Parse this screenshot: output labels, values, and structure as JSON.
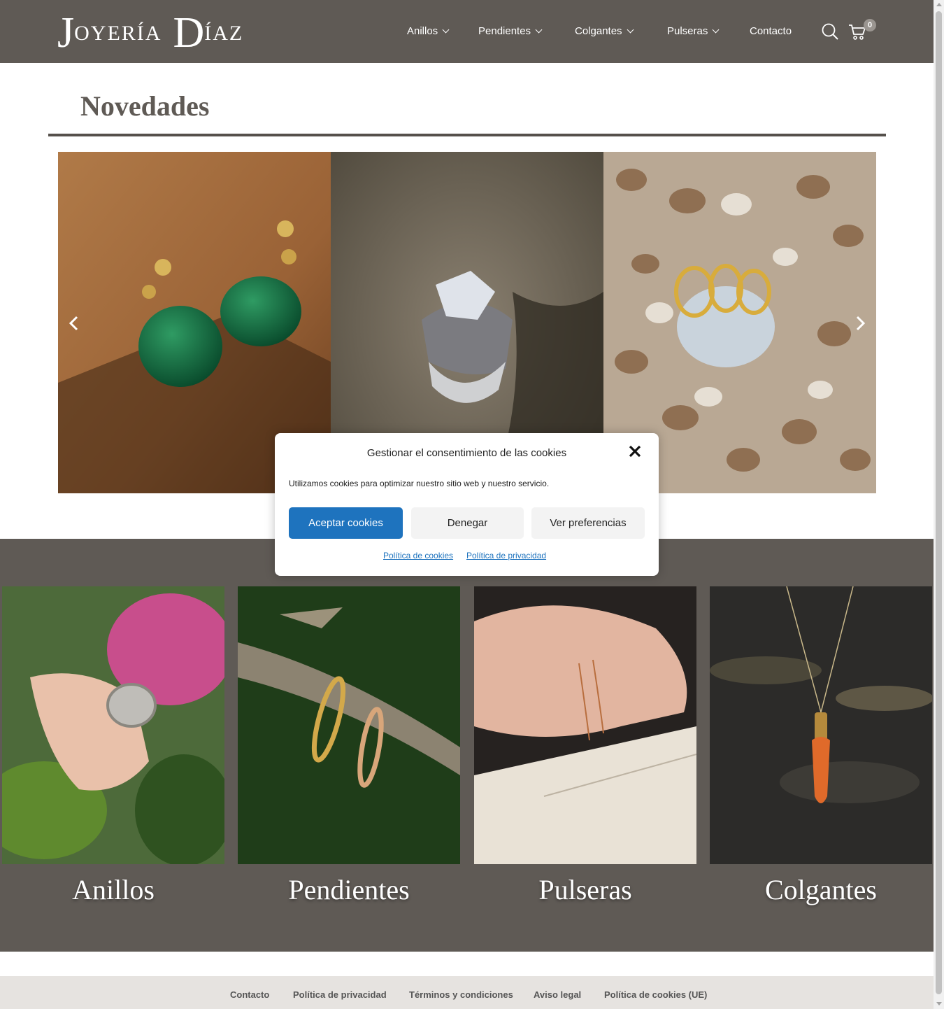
{
  "header": {
    "logo": {
      "initial_1": "J",
      "rest_1": "OYERÍA",
      "initial_2": "D",
      "rest_2": "ÍAZ"
    },
    "nav": [
      {
        "label": "Anillos",
        "has_dropdown": true
      },
      {
        "label": "Pendientes",
        "has_dropdown": true
      },
      {
        "label": "Colgantes",
        "has_dropdown": true
      },
      {
        "label": "Pulseras",
        "has_dropdown": true
      },
      {
        "label": "Contacto",
        "has_dropdown": false
      }
    ],
    "icons": {
      "search": "search-icon",
      "cart": "cart-icon"
    },
    "cart_count": "0"
  },
  "main": {
    "title": "Novedades",
    "slider": {
      "slides": [
        "earrings-green-stone",
        "ring-silver-quartz",
        "gold-rings-pebbles"
      ],
      "prev_icon": "chevron-left-icon",
      "next_icon": "chevron-right-icon"
    }
  },
  "categories": [
    {
      "label": "Anillos"
    },
    {
      "label": "Pendientes"
    },
    {
      "label": "Pulseras"
    },
    {
      "label": "Colgantes"
    }
  ],
  "cookie_modal": {
    "title": "Gestionar el consentimiento de las cookies",
    "text": "Utilizamos cookies para optimizar nuestro sitio web y nuestro servicio.",
    "accept": "Aceptar cookies",
    "deny": "Denegar",
    "preferences": "Ver preferencias",
    "cookie_policy": "Política de cookies",
    "privacy_policy": "Política de privacidad",
    "close_icon": "close-icon"
  },
  "footer": {
    "links": [
      "Contacto",
      "Política de privacidad",
      "Términos y condiciones",
      "Aviso legal",
      "Política de cookies (UE)"
    ]
  },
  "colors": {
    "header_bg": "#5f5a55",
    "accent": "#1e73be",
    "footer_bg": "#e6e3e0"
  }
}
